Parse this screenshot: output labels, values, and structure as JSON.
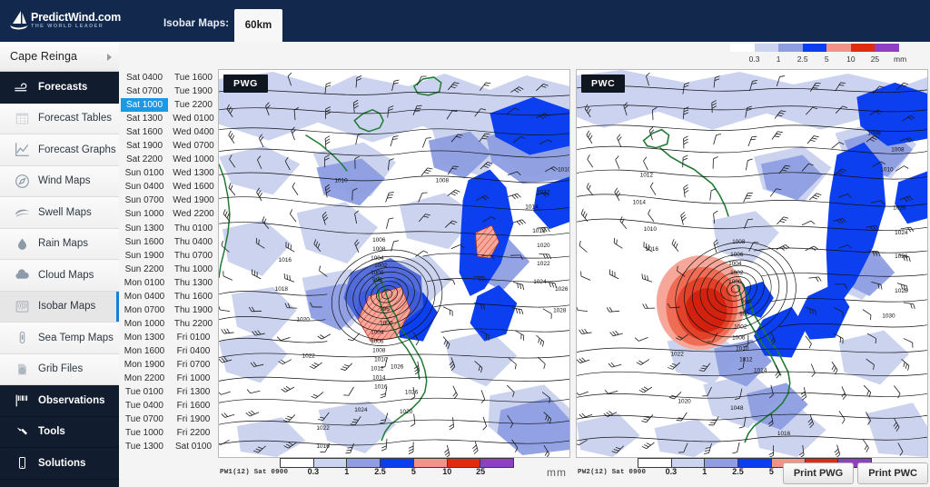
{
  "brand": {
    "name": "PredictWind.com",
    "tagline": "THE WORLD LEADER",
    "logo_icon": "sailboat-icon",
    "bar_color": "#12294d"
  },
  "header": {
    "maps_label": "Isobar Maps:",
    "resolution_tab": "60km"
  },
  "location": {
    "name": "Cape Reinga",
    "expand_icon": "chevron-right-icon"
  },
  "sidebar": {
    "items": [
      {
        "label": "Forecasts",
        "icon": "wind-icon",
        "style": "dark",
        "active": false
      },
      {
        "label": "Forecast Tables",
        "icon": "table-icon",
        "style": "light",
        "active": false
      },
      {
        "label": "Forecast Graphs",
        "icon": "line-chart-icon",
        "style": "light",
        "active": false
      },
      {
        "label": "Wind Maps",
        "icon": "compass-icon",
        "style": "light",
        "active": false
      },
      {
        "label": "Swell Maps",
        "icon": "wave-icon",
        "style": "light",
        "active": false
      },
      {
        "label": "Rain Maps",
        "icon": "raindrop-icon",
        "style": "light",
        "active": false
      },
      {
        "label": "Cloud Maps",
        "icon": "cloud-icon",
        "style": "light",
        "active": false
      },
      {
        "label": "Isobar Maps",
        "icon": "isobar-icon",
        "style": "light",
        "active": true
      },
      {
        "label": "Sea Temp Maps",
        "icon": "thermometer-icon",
        "style": "light",
        "active": false
      },
      {
        "label": "Grib Files",
        "icon": "grib-file-icon",
        "style": "light",
        "active": false
      },
      {
        "label": "Observations",
        "icon": "flags-icon",
        "style": "dark",
        "active": false
      },
      {
        "label": "Tools",
        "icon": "hammer-icon",
        "style": "dark",
        "active": false
      },
      {
        "label": "Solutions",
        "icon": "mobile-icon",
        "style": "dark",
        "active": false
      }
    ]
  },
  "legend": {
    "unit": "mm",
    "ticks": [
      "0.3",
      "1",
      "2.5",
      "5",
      "10",
      "25"
    ],
    "colors": [
      "#ffffff",
      "#ccd4f0",
      "#8e9ee0",
      "#0c3ef0",
      "#f2938a",
      "#dd2c10",
      "#8f3fc2"
    ]
  },
  "timeline": {
    "selected": "Sat 1000",
    "column1": [
      "Sat 0400",
      "Sat 0700",
      "Sat 1000",
      "Sat 1300",
      "Sat 1600",
      "Sat 1900",
      "Sat 2200",
      "Sun 0100",
      "Sun 0400",
      "Sun 0700",
      "Sun 1000",
      "Sun 1300",
      "Sun 1600",
      "Sun 1900",
      "Sun 2200",
      "Mon 0100",
      "Mon 0400",
      "Mon 0700",
      "Mon 1000",
      "Mon 1300",
      "Mon 1600",
      "Mon 1900",
      "Mon 2200",
      "Tue 0100",
      "Tue 0400",
      "Tue 0700",
      "Tue 1000",
      "Tue 1300"
    ],
    "column2": [
      "Tue 1600",
      "Tue 1900",
      "Tue 2200",
      "Wed 0100",
      "Wed 0400",
      "Wed 0700",
      "Wed 1000",
      "Wed 1300",
      "Wed 1600",
      "Wed 1900",
      "Wed 2200",
      "Thu 0100",
      "Thu 0400",
      "Thu 0700",
      "Thu 1000",
      "Thu 1300",
      "Thu 1600",
      "Thu 1900",
      "Thu 2200",
      "Fri 0100",
      "Fri 0400",
      "Fri 0700",
      "Fri 1000",
      "Fri 1300",
      "Fri 1600",
      "Fri 1900",
      "Fri 2200",
      "Sat 0100"
    ]
  },
  "maps": {
    "left": {
      "tag": "PWG",
      "footer_label": "PW1(12) Sat 0900",
      "unit": "mm"
    },
    "right": {
      "tag": "PWC",
      "footer_label": "PW2(12) Sat 0900",
      "unit": "mm"
    }
  },
  "actions": {
    "print_pwg": "Print PWG",
    "print_pwc": "Print PWC"
  }
}
